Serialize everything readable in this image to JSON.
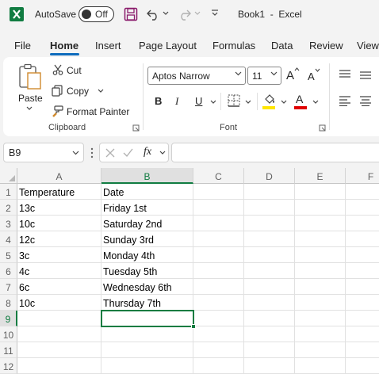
{
  "titlebar": {
    "autosave_label": "AutoSave",
    "autosave_state": "Off",
    "doc_title": "Book1  -  Excel"
  },
  "tabs": [
    "File",
    "Home",
    "Insert",
    "Page Layout",
    "Formulas",
    "Data",
    "Review",
    "View"
  ],
  "active_tab": "Home",
  "ribbon": {
    "paste": "Paste",
    "cut": "Cut",
    "copy": "Copy",
    "format_painter": "Format Painter",
    "clipboard_label": "Clipboard",
    "font_name": "Aptos Narrow",
    "font_size": "11",
    "bold": "B",
    "italic": "I",
    "underline": "U",
    "font_label": "Font",
    "grow_font": "A",
    "shrink_font": "A",
    "font_color_letter": "A"
  },
  "formula_bar": {
    "name_box": "B9",
    "fx": "fx",
    "formula": ""
  },
  "columns": [
    "A",
    "B",
    "C",
    "D",
    "E",
    "F"
  ],
  "rows": [
    "1",
    "2",
    "3",
    "4",
    "5",
    "6",
    "7",
    "8",
    "9",
    "10",
    "11",
    "12"
  ],
  "cells": [
    [
      "Temperature",
      "Date"
    ],
    [
      "13c",
      "Friday 1st"
    ],
    [
      "10c",
      "Saturday 2nd"
    ],
    [
      "12c",
      "Sunday 3rd"
    ],
    [
      "3c",
      "Monday 4th"
    ],
    [
      "4c",
      "Tuesday 5th"
    ],
    [
      "6c",
      "Wednesday 6th"
    ],
    [
      "10c",
      "Thursday 7th"
    ]
  ],
  "selected_cell": "B9",
  "colors": {
    "accent": "#107c41",
    "tab_underline": "#0f6cbd",
    "highlight_bar": "#ffe600",
    "font_color_bar": "#e00000"
  }
}
